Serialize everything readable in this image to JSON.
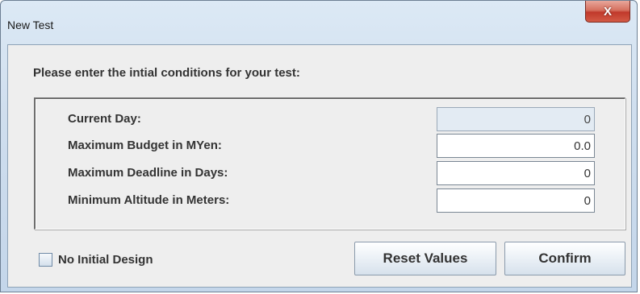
{
  "window": {
    "title": "New Test",
    "close_glyph": "X"
  },
  "dialog": {
    "prompt": "Please enter the intial conditions for your test:",
    "fields": [
      {
        "label": "Current Day:",
        "value": "0",
        "editable": false
      },
      {
        "label": "Maximum Budget in MYen:",
        "value": "0.0",
        "editable": true
      },
      {
        "label": "Maximum Deadline in Days:",
        "value": "0",
        "editable": true
      },
      {
        "label": "Minimum Altitude in Meters:",
        "value": "0",
        "editable": true
      }
    ],
    "checkbox": {
      "label": "No Initial Design",
      "checked": false
    },
    "buttons": {
      "reset": "Reset Values",
      "confirm": "Confirm"
    }
  },
  "icons": {
    "close": "close-icon"
  }
}
